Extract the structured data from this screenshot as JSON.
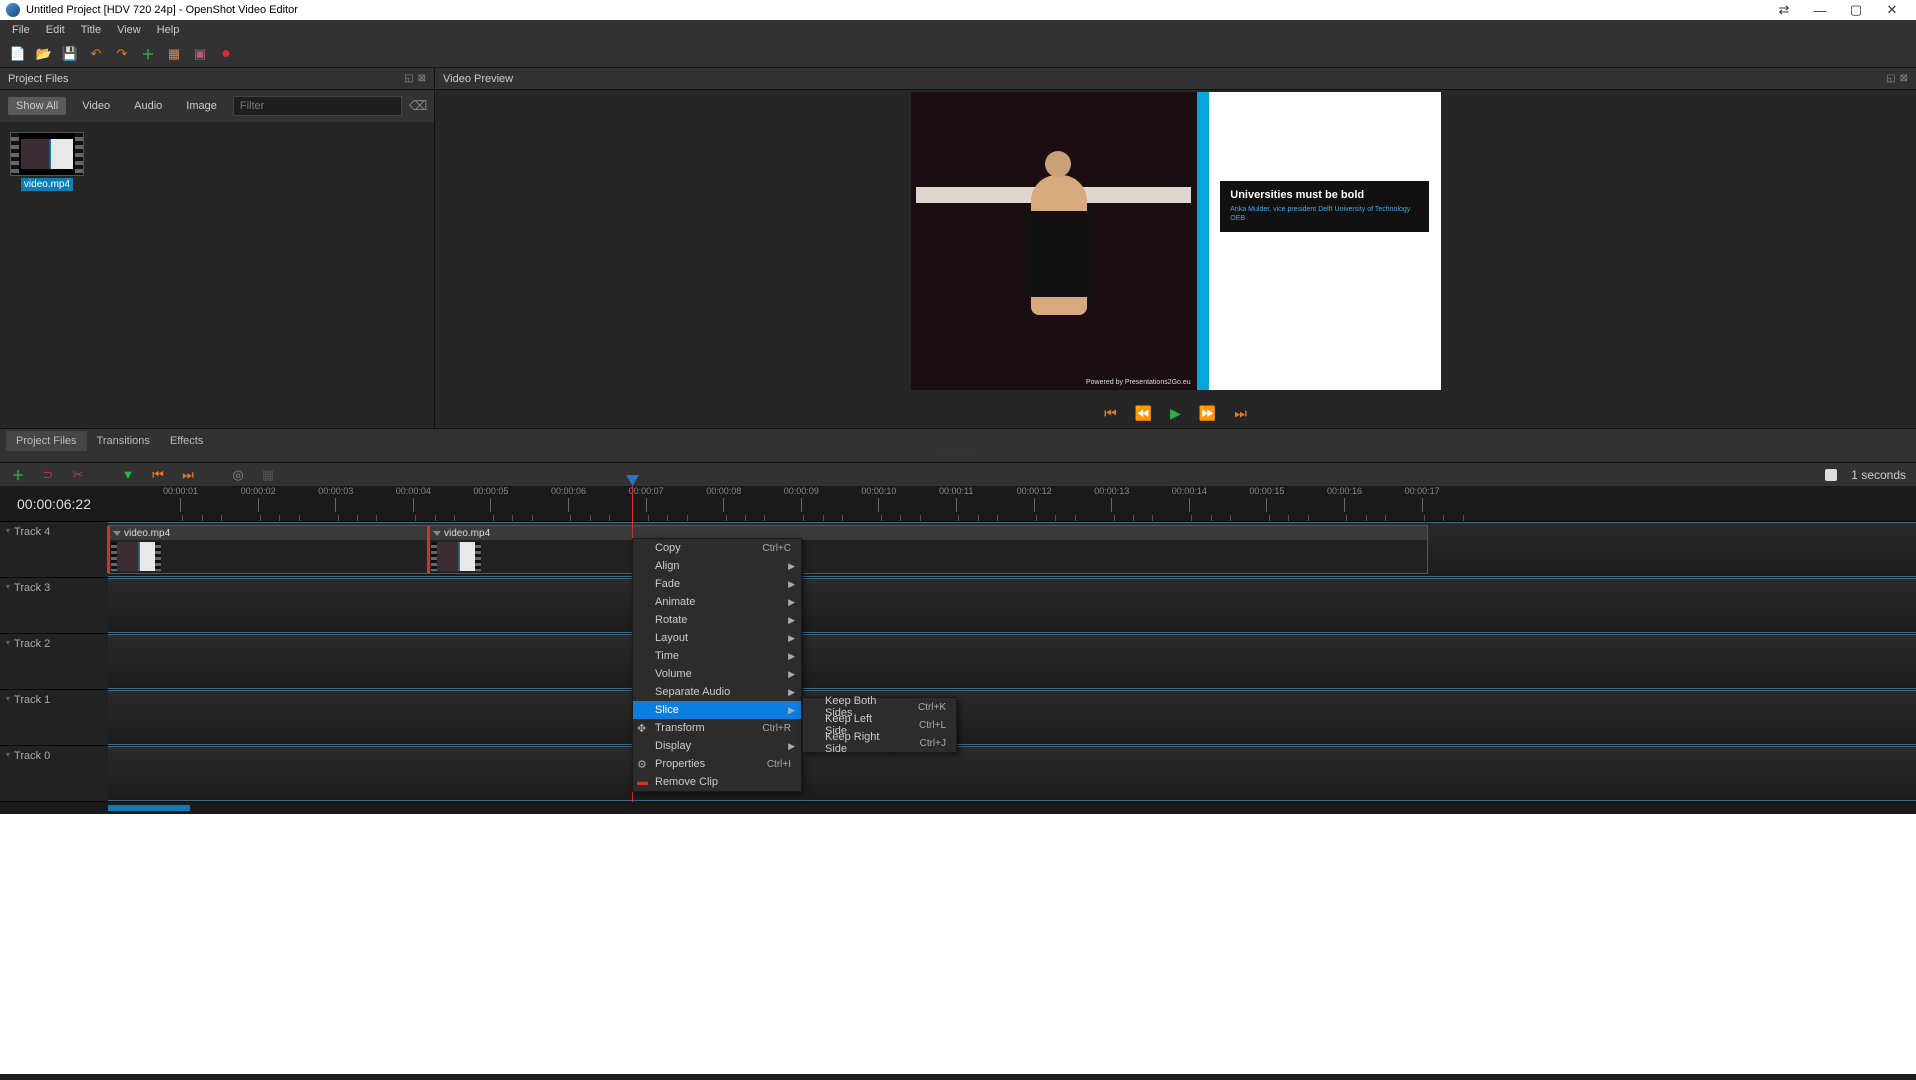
{
  "titlebar": {
    "text": "Untitled Project [HDV 720 24p] - OpenShot Video Editor"
  },
  "menubar": [
    "File",
    "Edit",
    "Title",
    "View",
    "Help"
  ],
  "panels": {
    "project_files": {
      "title": "Project Files"
    },
    "video_preview": {
      "title": "Video Preview"
    }
  },
  "pf_filters": {
    "show_all": "Show All",
    "video": "Video",
    "audio": "Audio",
    "image": "Image",
    "placeholder": "Filter"
  },
  "pf_clip": {
    "name": "video.mp4"
  },
  "pf_tabs": [
    "Project Files",
    "Transitions",
    "Effects"
  ],
  "preview": {
    "slide_title": "Universities must be bold",
    "slide_sub1": "Anka Mulder, vice president Delft University of Technology",
    "slide_sub2": "OEB",
    "powered": "Powered by Presentations2Go.eu"
  },
  "tl_toolbar": {
    "zoom_label": "1 seconds"
  },
  "tl_current": "00:00:06:22",
  "tl_ticks": [
    "00:00:01",
    "00:00:02",
    "00:00:03",
    "00:00:04",
    "00:00:05",
    "00:00:06",
    "00:00:07",
    "00:00:08",
    "00:00:09",
    "00:00:10",
    "00:00:11",
    "00:00:12",
    "00:00:13",
    "00:00:14",
    "00:00:15",
    "00:00:16",
    "00:00:17"
  ],
  "tracks": [
    "Track 4",
    "Track 3",
    "Track 2",
    "Track 1",
    "Track 0"
  ],
  "clips": [
    {
      "label": "video.mp4"
    },
    {
      "label": "video.mp4"
    }
  ],
  "ctx_main": [
    {
      "label": "Copy",
      "shortcut": "Ctrl+C"
    },
    {
      "label": "Align",
      "submenu": true
    },
    {
      "label": "Fade",
      "submenu": true
    },
    {
      "label": "Animate",
      "submenu": true
    },
    {
      "label": "Rotate",
      "submenu": true
    },
    {
      "label": "Layout",
      "submenu": true
    },
    {
      "label": "Time",
      "submenu": true
    },
    {
      "label": "Volume",
      "submenu": true
    },
    {
      "label": "Separate Audio",
      "submenu": true
    },
    {
      "label": "Slice",
      "submenu": true,
      "selected": true
    },
    {
      "label": "Transform",
      "shortcut": "Ctrl+R",
      "icon": "✥"
    },
    {
      "label": "Display",
      "submenu": true
    },
    {
      "label": "Properties",
      "shortcut": "Ctrl+I",
      "icon": "⚙"
    },
    {
      "label": "Remove Clip",
      "icon": "▬",
      "iconcolor": "#c33"
    }
  ],
  "ctx_sub": [
    {
      "label": "Keep Both Sides",
      "shortcut": "Ctrl+K"
    },
    {
      "label": "Keep Left Side",
      "shortcut": "Ctrl+L"
    },
    {
      "label": "Keep Right Side",
      "shortcut": "Ctrl+J"
    }
  ]
}
